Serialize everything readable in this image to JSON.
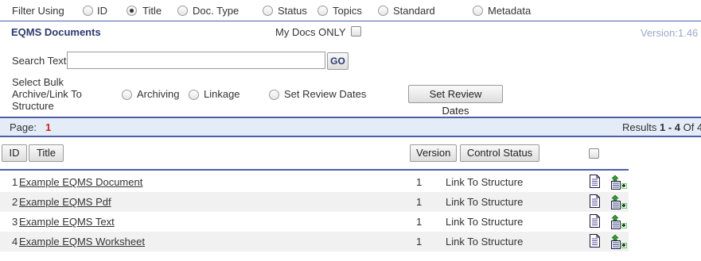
{
  "filter": {
    "label": "Filter Using",
    "options": [
      {
        "label": "ID",
        "checked": false
      },
      {
        "label": "Title",
        "checked": true
      },
      {
        "label": "Doc. Type",
        "checked": false
      },
      {
        "label": "Status",
        "checked": false
      },
      {
        "label": "Topics",
        "checked": false
      },
      {
        "label": "Standard",
        "checked": false
      },
      {
        "label": "Metadata",
        "checked": false
      }
    ]
  },
  "header": {
    "title": "EQMS Documents",
    "my_docs_label": "My Docs ONLY",
    "version": "Version:1.46"
  },
  "search": {
    "label": "Search Text",
    "value": "",
    "go_label": "GO"
  },
  "bulk": {
    "label_line1": "Select Bulk",
    "label_line2": "Archive/Link To",
    "label_line3": "Structure",
    "options": [
      "Archiving",
      "Linkage",
      "Set Review Dates"
    ],
    "button_label": "Set Review Dates"
  },
  "pager": {
    "page_label": "Page:",
    "page_number": "1",
    "results_prefix": "Results",
    "results_range": "1 - 4",
    "results_of": "Of 4"
  },
  "columns": {
    "id": "ID",
    "title": "Title",
    "version": "Version",
    "control_status": "Control Status"
  },
  "rows": [
    {
      "num": "1",
      "title": "Example EQMS Document",
      "version": "1",
      "status": "Link To Structure"
    },
    {
      "num": "2",
      "title": "Example EQMS Pdf",
      "version": "1",
      "status": "Link To Structure"
    },
    {
      "num": "3",
      "title": "Example EQMS Text",
      "version": "1",
      "status": "Link To Structure"
    },
    {
      "num": "4",
      "title": "Example EQMS Worksheet",
      "version": "1",
      "status": "Link To Structure"
    }
  ],
  "colors": {
    "accent_blue": "#4e5fa8",
    "pager_bg": "#e4ecf7",
    "page_number_red": "#d42020",
    "row_alt_bg": "#f1f1f1",
    "version_text": "#9aa8c8"
  }
}
